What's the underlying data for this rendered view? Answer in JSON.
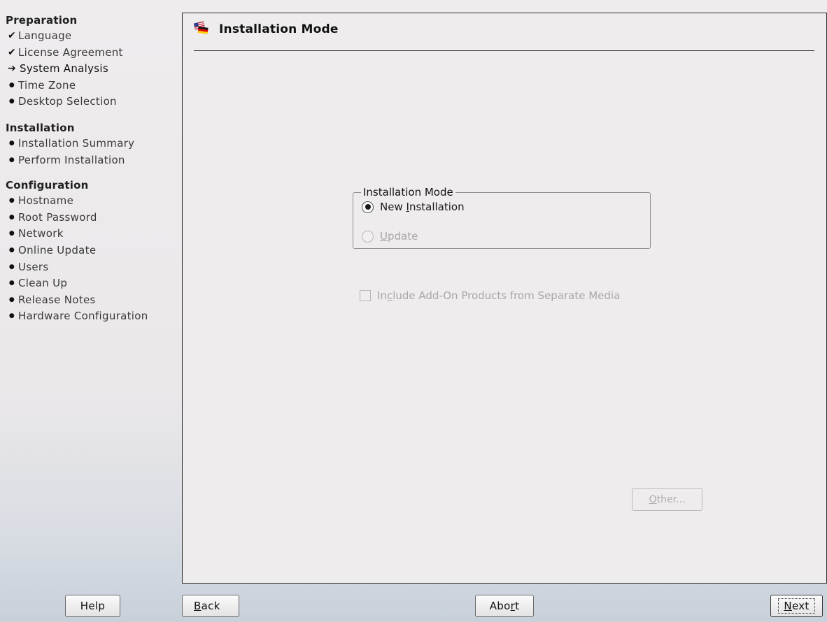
{
  "window": {
    "colors": {
      "background": "#efecee",
      "border": "#2c2c2c",
      "disabled_text": "#a9a6a8"
    }
  },
  "sidebar": {
    "sections": [
      {
        "title": "Preparation",
        "steps": [
          {
            "label": "Language",
            "state": "done",
            "marker": "✔"
          },
          {
            "label": "License Agreement",
            "state": "done",
            "marker": "✔"
          },
          {
            "label": "System Analysis",
            "state": "current",
            "marker": "➔"
          },
          {
            "label": "Time Zone",
            "state": "todo",
            "marker": "●"
          },
          {
            "label": "Desktop Selection",
            "state": "todo",
            "marker": "●"
          }
        ]
      },
      {
        "title": "Installation",
        "steps": [
          {
            "label": "Installation Summary",
            "state": "todo",
            "marker": "●"
          },
          {
            "label": "Perform Installation",
            "state": "todo",
            "marker": "●"
          }
        ]
      },
      {
        "title": "Configuration",
        "steps": [
          {
            "label": "Hostname",
            "state": "todo",
            "marker": "●"
          },
          {
            "label": "Root Password",
            "state": "todo",
            "marker": "●"
          },
          {
            "label": "Network",
            "state": "todo",
            "marker": "●"
          },
          {
            "label": "Online Update",
            "state": "todo",
            "marker": "●"
          },
          {
            "label": "Users",
            "state": "todo",
            "marker": "●"
          },
          {
            "label": "Clean Up",
            "state": "todo",
            "marker": "●"
          },
          {
            "label": "Release Notes",
            "state": "todo",
            "marker": "●"
          },
          {
            "label": "Hardware Configuration",
            "state": "todo",
            "marker": "●"
          }
        ]
      }
    ]
  },
  "main": {
    "title": "Installation Mode",
    "title_icon": "flags-icon",
    "mode_group": {
      "legend": "Installation Mode",
      "options": [
        {
          "label_pre": "New ",
          "label_mnemonic": "I",
          "label_post": "nstallation",
          "selected": true,
          "enabled": true
        },
        {
          "label_pre": "",
          "label_mnemonic": "U",
          "label_post": "pdate",
          "selected": false,
          "enabled": false
        }
      ]
    },
    "addon": {
      "label_pre": "In",
      "label_mnemonic": "c",
      "label_post": "lude Add-On Products from Separate Media",
      "checked": false,
      "enabled": false
    },
    "other_button": {
      "label_mnemonic": "O",
      "label_post": "ther...",
      "enabled": false
    }
  },
  "buttons": {
    "help": {
      "label": "Help"
    },
    "back": {
      "label_mnemonic": "B",
      "label_post": "ack"
    },
    "abort": {
      "label_pre": "Abo",
      "label_mnemonic": "r",
      "label_post": "t"
    },
    "next": {
      "label_mnemonic": "N",
      "label_post": "ext"
    }
  }
}
